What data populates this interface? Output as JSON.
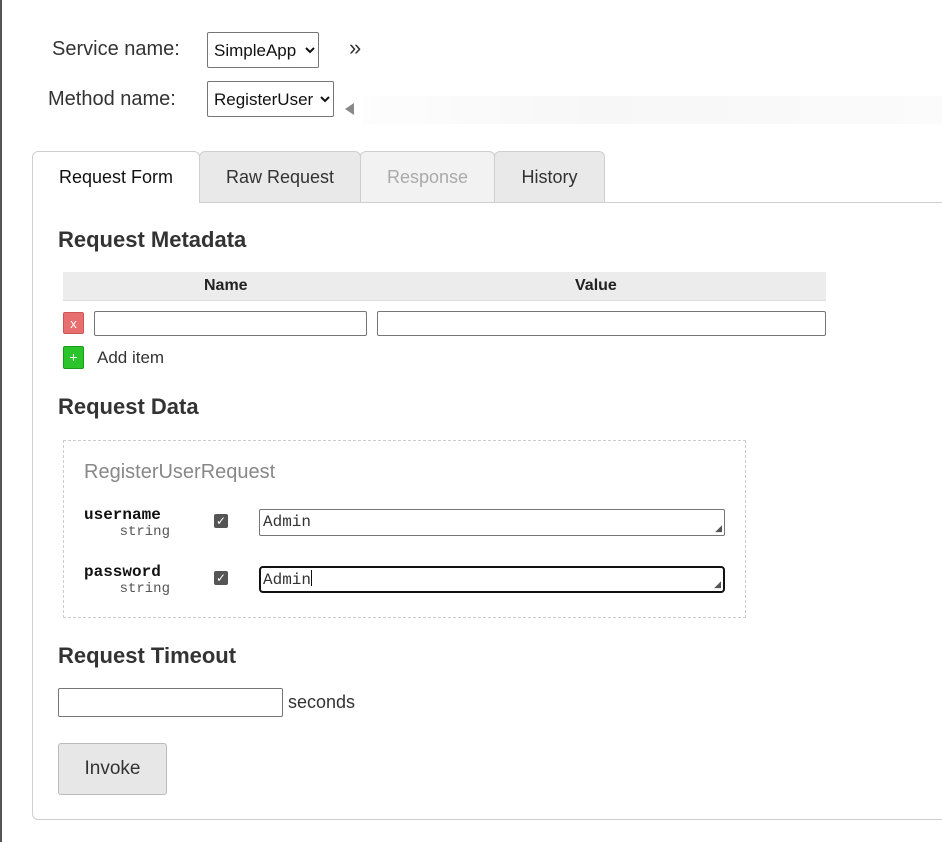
{
  "header": {
    "service_label": "Service name:",
    "service_value": "SimpleApp",
    "method_label": "Method name:",
    "method_value": "RegisterUser",
    "expand_glyph": "»"
  },
  "tabs": [
    {
      "label": "Request Form",
      "state": "active"
    },
    {
      "label": "Raw Request",
      "state": "normal"
    },
    {
      "label": "Response",
      "state": "disabled"
    },
    {
      "label": "History",
      "state": "normal"
    }
  ],
  "metadata": {
    "title": "Request Metadata",
    "col_name": "Name",
    "col_value": "Value",
    "rows": [
      {
        "name": "",
        "value": ""
      }
    ],
    "remove_glyph": "x",
    "add_glyph": "+",
    "add_label": "Add item"
  },
  "request_data": {
    "title": "Request Data",
    "message_type": "RegisterUserRequest",
    "fields": [
      {
        "name": "username",
        "type": "string",
        "included": true,
        "value": "Admin"
      },
      {
        "name": "password",
        "type": "string",
        "included": true,
        "value": "Admin"
      }
    ]
  },
  "timeout": {
    "title": "Request Timeout",
    "value": "",
    "unit": "seconds"
  },
  "invoke_label": "Invoke",
  "colors": {
    "remove_button": "#e76f6f",
    "add_button": "#2bc52b"
  }
}
